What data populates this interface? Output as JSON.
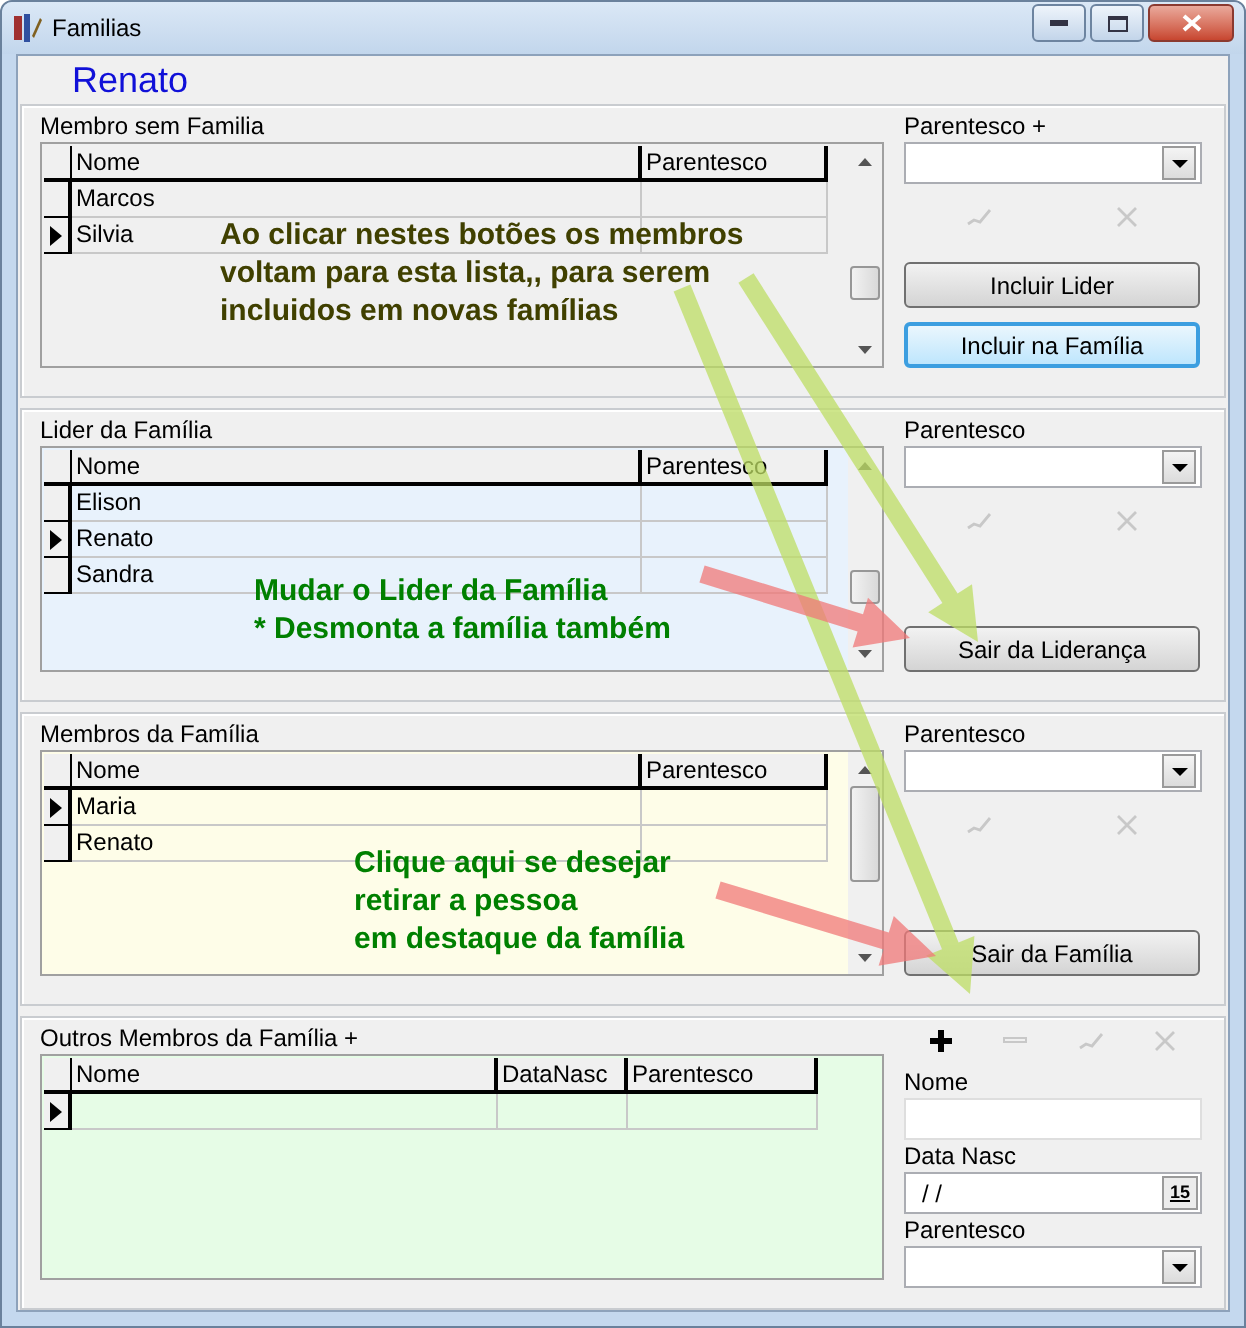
{
  "window": {
    "title": "Familias"
  },
  "person": "Renato",
  "sections": [
    {
      "title": "Membro sem Familia",
      "color": "#f0f0f0",
      "columns": [
        "Nome",
        "Parentesco"
      ],
      "rows": [
        {
          "nome": "Marcos",
          "selected": false
        },
        {
          "nome": "Silvia",
          "selected": true
        }
      ],
      "right": {
        "kind": "combo",
        "label": "Parentesco +",
        "tools": [
          {
            "kind": "confirm",
            "disabled": true
          },
          {
            "kind": "cancel",
            "disabled": true
          }
        ],
        "buttons": [
          {
            "label": "Incluir Lider",
            "focused": false
          },
          {
            "label": "Incluir na Família",
            "focused": true
          }
        ]
      }
    },
    {
      "title": "Lider da Família",
      "color": "#e8f2fc",
      "columns": [
        "Nome",
        "Parentesco"
      ],
      "rows": [
        {
          "nome": "Elison",
          "selected": false
        },
        {
          "nome": "Renato",
          "selected": true
        },
        {
          "nome": "Sandra",
          "selected": false
        }
      ],
      "right": {
        "kind": "combo",
        "label": "Parentesco",
        "tools": [
          {
            "kind": "confirm",
            "disabled": true
          },
          {
            "kind": "cancel",
            "disabled": true
          }
        ],
        "buttons": [
          {
            "label": "Sair da Liderança",
            "focused": false
          }
        ]
      }
    },
    {
      "title": "Membros da Família",
      "color": "#fefde8",
      "columns": [
        "Nome",
        "Parentesco"
      ],
      "rows": [
        {
          "nome": "Maria",
          "selected": true
        },
        {
          "nome": "Renato",
          "selected": false
        }
      ],
      "right": {
        "kind": "combo",
        "label": "Parentesco",
        "tools": [
          {
            "kind": "confirm",
            "disabled": true
          },
          {
            "kind": "cancel",
            "disabled": true
          }
        ],
        "buttons": [
          {
            "label": "Sair da Família",
            "focused": false
          }
        ]
      }
    },
    {
      "title": "Outros Membros da Família +",
      "color": "#e6fce6",
      "columns": [
        "Nome",
        "DataNasc",
        "Parentesco"
      ],
      "rows": [
        {
          "selected": true
        }
      ],
      "right": {
        "kind": "form",
        "tools": [
          {
            "kind": "add",
            "disabled": false
          },
          {
            "kind": "remove",
            "disabled": true
          },
          {
            "kind": "confirm",
            "disabled": true
          },
          {
            "kind": "cancel",
            "disabled": true
          }
        ],
        "fields": [
          {
            "kind": "text",
            "label": "Nome"
          },
          {
            "kind": "date",
            "label": "Data Nasc",
            "value": "/ /",
            "calendar": "15"
          },
          {
            "kind": "combo",
            "label": "Parentesco"
          }
        ]
      }
    }
  ],
  "annotations": [
    {
      "text": "Ao clicar nestes botões os membros\nvoltam para esta lista,, para serem\nincluidos em novas famílias",
      "color": "#404000"
    },
    {
      "text": "Mudar o Lider da Família\n* Desmonta a família também",
      "color": "#008000"
    },
    {
      "text": "Clique aqui se desejar\nretirar a pessoa\nem destaque da família",
      "color": "#008000"
    }
  ]
}
